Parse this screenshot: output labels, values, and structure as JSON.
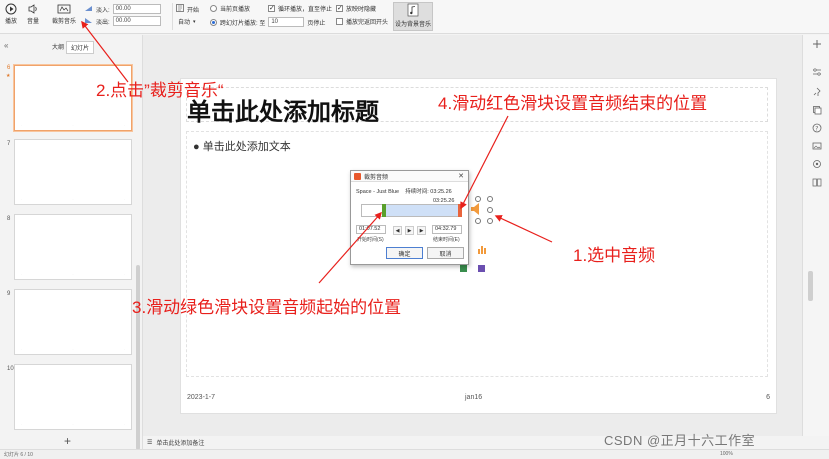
{
  "ribbon": {
    "play": "播放",
    "volume": "音量",
    "trim_audio": "裁剪音乐",
    "fade_in_label": "淡入:",
    "fade_in_value": "00.00",
    "fade_out_label": "淡出:",
    "fade_out_value": "00.00",
    "start_label": "开始",
    "start_value": "自动",
    "opt_current_page": "当前页播放",
    "opt_cross_slides": "跨幻灯片播放: 至",
    "cross_slides_value": "10",
    "page_stop": "页停止",
    "loop_play": "循环播放，直至停止",
    "hide_during_show": "放映时隐藏",
    "rewind_after_play": "播放完返回开头",
    "set_bgm": "设为背景音乐"
  },
  "left_panel": {
    "tab_outline": "大纲",
    "tab_slides": "幻灯片",
    "thumbnails": [
      {
        "num": "6"
      },
      {
        "num": "7"
      },
      {
        "num": "8"
      },
      {
        "num": "9"
      },
      {
        "num": "10"
      }
    ]
  },
  "slide": {
    "title": "单击此处添加标题",
    "body": "● 单击此处添加文本",
    "date": "2023-1-7",
    "footer": "jan16",
    "page_number": "6"
  },
  "dialog": {
    "title": "裁剪音频",
    "track_name": "Space - Just Blue",
    "duration_label": "持续时间:",
    "duration_value": "03:25.26",
    "bubble_time": "03:25.26",
    "start_time": "01:07.52",
    "end_time": "04:32.79",
    "start_label": "开始时间(S)",
    "end_label": "结束时间(E)",
    "ok": "确定",
    "cancel": "取消"
  },
  "annotations": {
    "step1": "1.选中音频",
    "step2": "2.点击”裁剪音乐“",
    "step3": "3.滑动绿色滑块设置音频起始的位置",
    "step4": "4.滑动红色滑块设置音频结束的位置"
  },
  "notes": {
    "placeholder": "单击此处添加备注"
  },
  "status": {
    "left": "幻灯片 6 / 10",
    "right": "100%"
  },
  "watermark": "CSDN @正月十六工作室",
  "colors": {
    "annotation_red": "#e8201c",
    "slider_green": "#5aa02c",
    "slider_red": "#e8643c",
    "selection_orange": "#f0a26a"
  }
}
